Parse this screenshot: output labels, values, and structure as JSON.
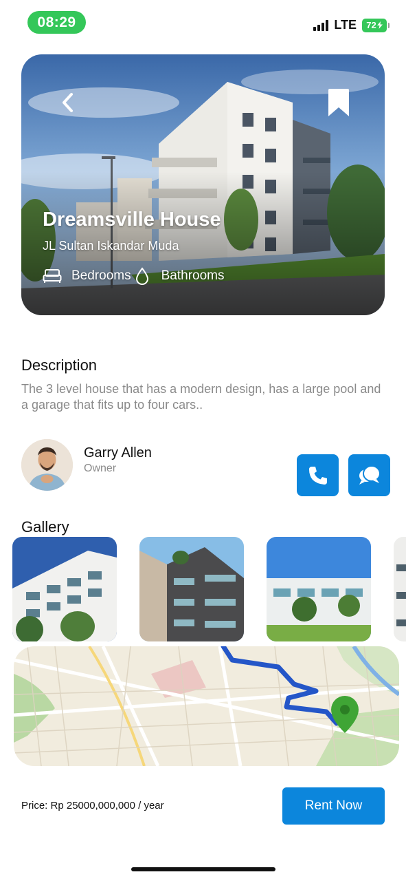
{
  "status_bar": {
    "time": "08:29",
    "network": "LTE",
    "battery": "72"
  },
  "property": {
    "name": "Dreamsville House",
    "address": "JL Sultan Iskandar Muda",
    "features": [
      {
        "icon": "bed-icon",
        "label": "Bedrooms"
      },
      {
        "icon": "water-drop-icon",
        "label": "Bathrooms"
      }
    ]
  },
  "description": {
    "heading": "Description",
    "text": "The 3 level house that has a modern design, has a large pool and a garage that fits up to four cars.."
  },
  "owner": {
    "name": "Garry Allen",
    "role": "Owner",
    "actions": [
      "phone-icon",
      "chat-icon"
    ]
  },
  "gallery": {
    "heading": "Gallery"
  },
  "footer": {
    "price": "Price: Rp 25000,000,000 / year",
    "cta": "Rent Now"
  },
  "colors": {
    "accent": "#0C86DC",
    "status_green": "#34C759",
    "muted_text": "#8A8A8A",
    "route_blue": "#2456C8",
    "pin_green": "#3FA535"
  }
}
